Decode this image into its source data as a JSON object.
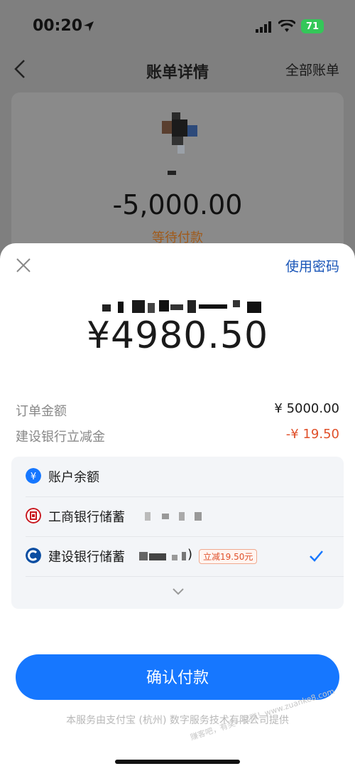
{
  "status": {
    "time": "00:20",
    "battery": "71"
  },
  "nav": {
    "title": "账单详情",
    "right": "全部账单"
  },
  "bill": {
    "amount": "-5,000.00",
    "status": "等待付款"
  },
  "sheet": {
    "use_password": "使用密码",
    "pay_amount": "¥4980.50",
    "order_label": "订单金额",
    "order_value": "¥ 5000.00",
    "discount_label": "建设银行立减金",
    "discount_value": "-¥ 19.50",
    "methods": [
      {
        "name": "账户余额",
        "icon": "balance-icon",
        "color": "#1677ff"
      },
      {
        "name": "工商银行储蓄",
        "icon": "icbc-icon",
        "color": "#c8161d"
      },
      {
        "name": "建设银行储蓄",
        "suffix": ")",
        "tag": "立减19.50元",
        "icon": "ccb-icon",
        "color": "#0b4ea2",
        "selected": true
      }
    ],
    "confirm": "确认付款",
    "footer": "本服务由支付宝 (杭州) 数字服务技术有限公司提供",
    "watermark": "赚客吧，有奖一起赚！www.zuanke8.com"
  }
}
